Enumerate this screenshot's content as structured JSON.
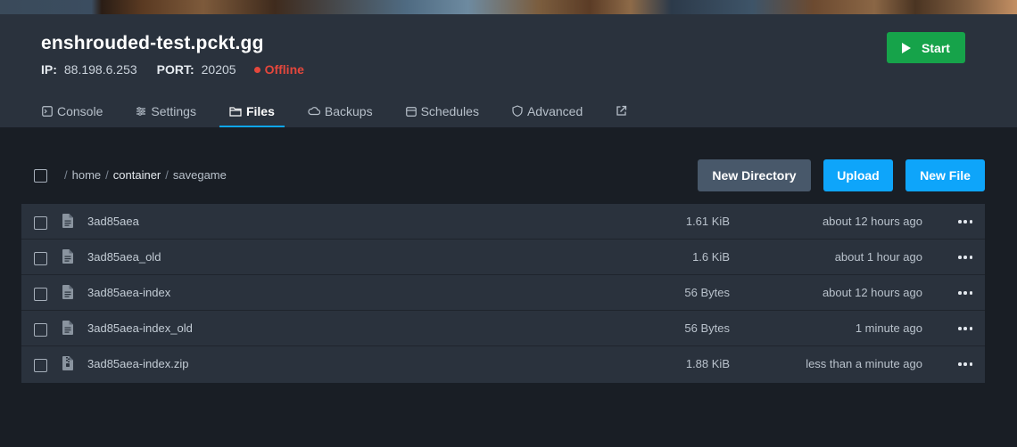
{
  "server": {
    "name": "enshrouded-test.pckt.gg",
    "ip_label": "IP:",
    "ip": "88.198.6.253",
    "port_label": "PORT:",
    "port": "20205",
    "status": "Offline",
    "status_color": "#e4473c"
  },
  "actions": {
    "start_label": "Start"
  },
  "tabs": [
    {
      "label": "Console",
      "icon": "terminal-icon"
    },
    {
      "label": "Settings",
      "icon": "sliders-icon"
    },
    {
      "label": "Files",
      "icon": "folder-icon",
      "active": true
    },
    {
      "label": "Backups",
      "icon": "cloud-icon"
    },
    {
      "label": "Schedules",
      "icon": "calendar-icon"
    },
    {
      "label": "Advanced",
      "icon": "shield-icon"
    },
    {
      "label": "",
      "icon": "external-link-icon"
    }
  ],
  "breadcrumb": {
    "sep": "/",
    "parts": [
      "home",
      "container",
      "savegame"
    ]
  },
  "toolbar": {
    "new_directory": "New Directory",
    "upload": "Upload",
    "new_file": "New File"
  },
  "files": [
    {
      "name": "3ad85aea",
      "size": "1.61 KiB",
      "modified": "about 12 hours ago",
      "icon": "file-text-icon"
    },
    {
      "name": "3ad85aea_old",
      "size": "1.6 KiB",
      "modified": "about 1 hour ago",
      "icon": "file-text-icon"
    },
    {
      "name": "3ad85aea-index",
      "size": "56 Bytes",
      "modified": "about 12 hours ago",
      "icon": "file-text-icon"
    },
    {
      "name": "3ad85aea-index_old",
      "size": "56 Bytes",
      "modified": "1 minute ago",
      "icon": "file-text-icon"
    },
    {
      "name": "3ad85aea-index.zip",
      "size": "1.88 KiB",
      "modified": "less than a minute ago",
      "icon": "file-archive-icon"
    }
  ],
  "colors": {
    "accent": "#0ea5e9",
    "primary_button": "#0ea5fa",
    "start_button": "#16a34a",
    "secondary_button": "#48586a"
  }
}
